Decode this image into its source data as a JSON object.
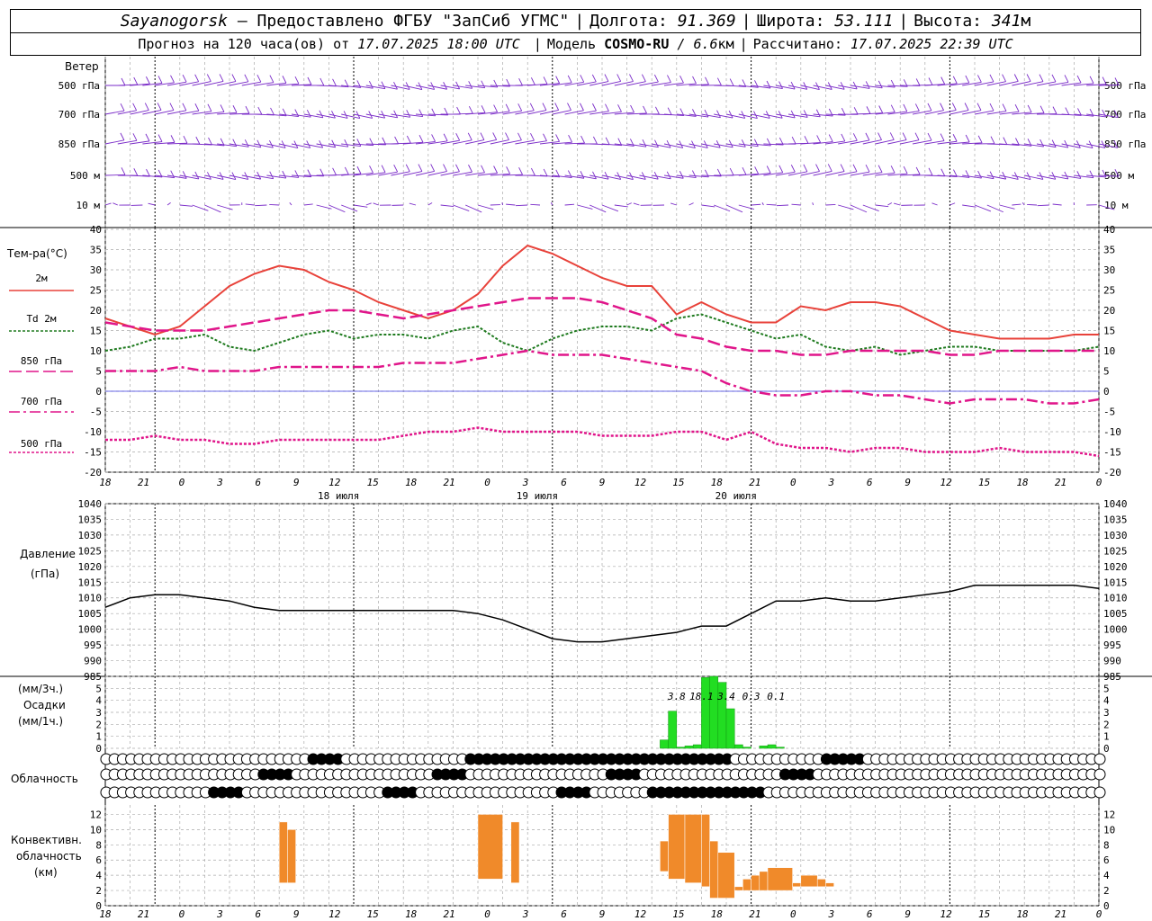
{
  "header": {
    "station": "Sayanogorsk",
    "dash": "—",
    "provider": "Предоставлено ФГБУ \"ЗапСиб УГМС\"",
    "lon_label": "Долгота:",
    "lon": "91.369",
    "lat_label": "Широта:",
    "lat": "53.111",
    "alt_label": "Высота:",
    "alt": "341",
    "alt_unit": "м",
    "forecast_prefix": "Прогноз на 120 часа(ов) от",
    "forecast_time": "17.07.2025 18:00 UTC",
    "model_label": "Модель",
    "model_name": "COSMO-RU",
    "model_res": "/ 6.6",
    "model_unit": "км",
    "calc_label": "Рассчитано:",
    "calc_time": "17.07.2025 22:39 UTC"
  },
  "panels": {
    "wind": {
      "title": "Ветер",
      "levels": [
        "500 гПа",
        "700 гПа",
        "850 гПа",
        "500 м",
        "10 м"
      ],
      "color": "#7a2bc8"
    },
    "temperature": {
      "title": "Тем-ра(°C)",
      "legend": [
        {
          "label": "2м",
          "color": "#e8423a",
          "style": "solid"
        },
        {
          "label": "Td  2м",
          "color": "#1e7a1e",
          "style": "dotted"
        },
        {
          "label": "850 гПа",
          "color": "#e0158a",
          "style": "longdash"
        },
        {
          "label": "700 гПа",
          "color": "#e0158a",
          "style": "dashdot"
        },
        {
          "label": "500 гПа",
          "color": "#e0158a",
          "style": "dotted"
        }
      ]
    },
    "pressure": {
      "title": "Давление",
      "unit": "(гПа)"
    },
    "precip": {
      "unit1": "(мм/3ч.)",
      "title": "Осадки",
      "unit2": "(мм/1ч.)",
      "totals": [
        "3.8",
        "18.1",
        "3.4",
        "0.3",
        "0.1"
      ],
      "color": "#22dd22"
    },
    "cloud": {
      "title": "Облачность"
    },
    "convective": {
      "title1": "Конвективн.",
      "title2": "облачность",
      "unit": "(км)",
      "color": "#f08a2a"
    }
  },
  "time_axis": {
    "hour_labels": [
      "18",
      "21",
      "0",
      "3",
      "6",
      "9",
      "12",
      "15",
      "18",
      "21",
      "0",
      "3",
      "6",
      "9",
      "12",
      "15",
      "18",
      "21",
      "0",
      "3",
      "6",
      "9",
      "12",
      "15",
      "18",
      "21",
      "0"
    ],
    "day_labels": [
      "18 июля",
      "19 июля",
      "20 июля"
    ]
  },
  "chart_data": [
    {
      "type": "line",
      "title": "Тем-ра(°C)",
      "x_hours": [
        0,
        3,
        6,
        9,
        12,
        15,
        18,
        21,
        24,
        27,
        30,
        33,
        36,
        39,
        42,
        45,
        48,
        51,
        54,
        57,
        60,
        63,
        66,
        69,
        72,
        75,
        78,
        81,
        84,
        87,
        90,
        93,
        96,
        99,
        102,
        105,
        108,
        111,
        114,
        117,
        120
      ],
      "series": [
        {
          "name": "2м",
          "values": [
            18,
            16,
            14,
            16,
            21,
            26,
            29,
            31,
            30,
            27,
            25,
            22,
            20,
            18,
            20,
            24,
            31,
            36,
            34,
            31,
            28,
            26,
            26,
            19,
            22,
            19,
            17,
            17,
            21,
            20,
            22,
            22,
            21,
            18,
            15,
            14,
            13,
            13,
            13,
            14,
            14
          ]
        },
        {
          "name": "Td  2м",
          "values": [
            10,
            11,
            13,
            13,
            14,
            11,
            10,
            12,
            14,
            15,
            13,
            14,
            14,
            13,
            15,
            16,
            12,
            10,
            13,
            15,
            16,
            16,
            15,
            18,
            19,
            17,
            15,
            13,
            14,
            11,
            10,
            11,
            9,
            10,
            11,
            11,
            10,
            10,
            10,
            10,
            11
          ]
        },
        {
          "name": "850 гПа",
          "values": [
            17,
            16,
            15,
            15,
            15,
            16,
            17,
            18,
            19,
            20,
            20,
            19,
            18,
            19,
            20,
            21,
            22,
            23,
            23,
            23,
            22,
            20,
            18,
            14,
            13,
            11,
            10,
            10,
            9,
            9,
            10,
            10,
            10,
            10,
            9,
            9,
            10,
            10,
            10,
            10,
            10
          ]
        },
        {
          "name": "700 гПа",
          "values": [
            5,
            5,
            5,
            6,
            5,
            5,
            5,
            6,
            6,
            6,
            6,
            6,
            7,
            7,
            7,
            8,
            9,
            10,
            9,
            9,
            9,
            8,
            7,
            6,
            5,
            2,
            0,
            -1,
            -1,
            0,
            0,
            -1,
            -1,
            -2,
            -3,
            -2,
            -2,
            -2,
            -3,
            -3,
            -2
          ]
        },
        {
          "name": "500 гПа",
          "values": [
            -12,
            -12,
            -11,
            -12,
            -12,
            -13,
            -13,
            -12,
            -12,
            -12,
            -12,
            -12,
            -11,
            -10,
            -10,
            -9,
            -10,
            -10,
            -10,
            -10,
            -11,
            -11,
            -11,
            -10,
            -10,
            -12,
            -10,
            -13,
            -14,
            -14,
            -15,
            -14,
            -14,
            -15,
            -15,
            -15,
            -14,
            -15,
            -15,
            -15,
            -16
          ]
        }
      ],
      "ylim": [
        -20,
        40
      ],
      "yticks": [
        -20,
        -15,
        -10,
        -5,
        0,
        5,
        10,
        15,
        20,
        25,
        30,
        35,
        40
      ]
    },
    {
      "type": "line",
      "title": "Давление",
      "ylabel": "(гПа)",
      "x_hours": [
        0,
        3,
        6,
        9,
        12,
        15,
        18,
        21,
        24,
        27,
        30,
        33,
        36,
        39,
        42,
        45,
        48,
        51,
        54,
        57,
        60,
        63,
        66,
        69,
        72,
        75,
        78,
        81,
        84,
        87,
        90,
        93,
        96,
        99,
        102,
        105,
        108,
        111,
        114,
        117,
        120
      ],
      "series": [
        {
          "name": "",
          "values": [
            1007,
            1010,
            1011,
            1011,
            1010,
            1009,
            1007,
            1006,
            1006,
            1006,
            1006,
            1006,
            1006,
            1006,
            1006,
            1005,
            1003,
            1000,
            997,
            996,
            996,
            997,
            998,
            999,
            1001,
            1001,
            1005,
            1009,
            1009,
            1010,
            1009,
            1009,
            1010,
            1011,
            1012,
            1014,
            1014,
            1014,
            1014,
            1014,
            1013
          ]
        }
      ],
      "ylim": [
        985,
        1040
      ],
      "yticks": [
        985,
        990,
        995,
        1000,
        1005,
        1010,
        1015,
        1020,
        1025,
        1030,
        1035,
        1040
      ]
    },
    {
      "type": "bar",
      "title": "Осадки",
      "ylabel": "(мм/1ч.)",
      "x_hours": [
        67,
        68,
        69,
        70,
        71,
        72,
        73,
        74,
        75,
        76,
        77,
        79,
        80,
        81
      ],
      "values": [
        0.7,
        3.1,
        0.1,
        0.2,
        0.3,
        5.9,
        6.0,
        5.5,
        3.3,
        0.3,
        0.1,
        0.2,
        0.3,
        0.1
      ],
      "totals_at_hours": [
        {
          "x": 69,
          "label": "3.8"
        },
        {
          "x": 72,
          "label": "18.1"
        },
        {
          "x": 75,
          "label": "3.4"
        },
        {
          "x": 78,
          "label": "0.3"
        },
        {
          "x": 81,
          "label": "0.1"
        }
      ],
      "ylim": [
        0,
        6
      ],
      "yticks": [
        0,
        1,
        2,
        3,
        4,
        5
      ]
    },
    {
      "type": "bar",
      "title": "Конвективн. облачность",
      "ylabel": "(км)",
      "note": "floating bars: base and top height",
      "bars": [
        {
          "x0": 21,
          "x1": 22,
          "bottom": 3,
          "top": 11
        },
        {
          "x0": 22,
          "x1": 23,
          "bottom": 3,
          "top": 10
        },
        {
          "x0": 45,
          "x1": 48,
          "bottom": 3.5,
          "top": 12
        },
        {
          "x0": 49,
          "x1": 50,
          "bottom": 3,
          "top": 11
        },
        {
          "x0": 67,
          "x1": 68,
          "bottom": 4.5,
          "top": 8.5
        },
        {
          "x0": 68,
          "x1": 70,
          "bottom": 3.5,
          "top": 12
        },
        {
          "x0": 70,
          "x1": 72,
          "bottom": 3,
          "top": 12
        },
        {
          "x0": 72,
          "x1": 73,
          "bottom": 2.5,
          "top": 12
        },
        {
          "x0": 73,
          "x1": 74,
          "bottom": 1,
          "top": 8.5
        },
        {
          "x0": 74,
          "x1": 76,
          "bottom": 1,
          "top": 7
        },
        {
          "x0": 76,
          "x1": 77,
          "bottom": 2,
          "top": 2.5
        },
        {
          "x0": 77,
          "x1": 78,
          "bottom": 2,
          "top": 3.5
        },
        {
          "x0": 78,
          "x1": 79,
          "bottom": 2,
          "top": 4
        },
        {
          "x0": 79,
          "x1": 80,
          "bottom": 2,
          "top": 4.5
        },
        {
          "x0": 80,
          "x1": 83,
          "bottom": 2,
          "top": 5
        },
        {
          "x0": 83,
          "x1": 84,
          "bottom": 2.5,
          "top": 3
        },
        {
          "x0": 84,
          "x1": 86,
          "bottom": 2.5,
          "top": 4
        },
        {
          "x0": 86,
          "x1": 87,
          "bottom": 2.5,
          "top": 3.5
        },
        {
          "x0": 87,
          "x1": 88,
          "bottom": 2.5,
          "top": 3
        }
      ],
      "ylim": [
        0,
        13
      ],
      "yticks": [
        0,
        2,
        4,
        6,
        8,
        10,
        12
      ]
    }
  ]
}
